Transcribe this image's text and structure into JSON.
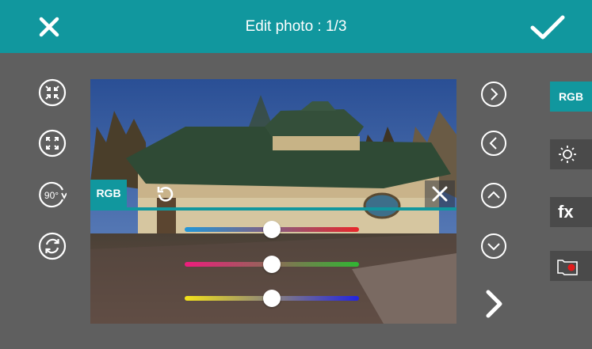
{
  "header": {
    "title": "Edit photo : 1/3"
  },
  "left_tools": [
    {
      "name": "collapse-arrows-icon"
    },
    {
      "name": "expand-arrows-icon"
    },
    {
      "name": "rotate-90-icon",
      "label": "90°"
    },
    {
      "name": "refresh-icon"
    }
  ],
  "rgb_panel": {
    "tab_label": "RGB",
    "sliders": [
      {
        "name": "cyan-red",
        "from": "#2196d8",
        "to": "#e8262a",
        "value": 0.5
      },
      {
        "name": "magenta-green",
        "from": "#ee1c7d",
        "to": "#2fb732",
        "value": 0.5
      },
      {
        "name": "yellow-blue",
        "from": "#f3e21a",
        "to": "#2224e0",
        "value": 0.5
      }
    ]
  },
  "side_buttons": [
    {
      "name": "rgb",
      "label": "RGB",
      "active": true
    },
    {
      "name": "brightness",
      "icon": "sun-icon"
    },
    {
      "name": "effects",
      "label": "fx"
    },
    {
      "name": "record",
      "icon": "record-icon"
    }
  ],
  "colors": {
    "accent": "#11979e",
    "background": "#5f5f5f"
  }
}
